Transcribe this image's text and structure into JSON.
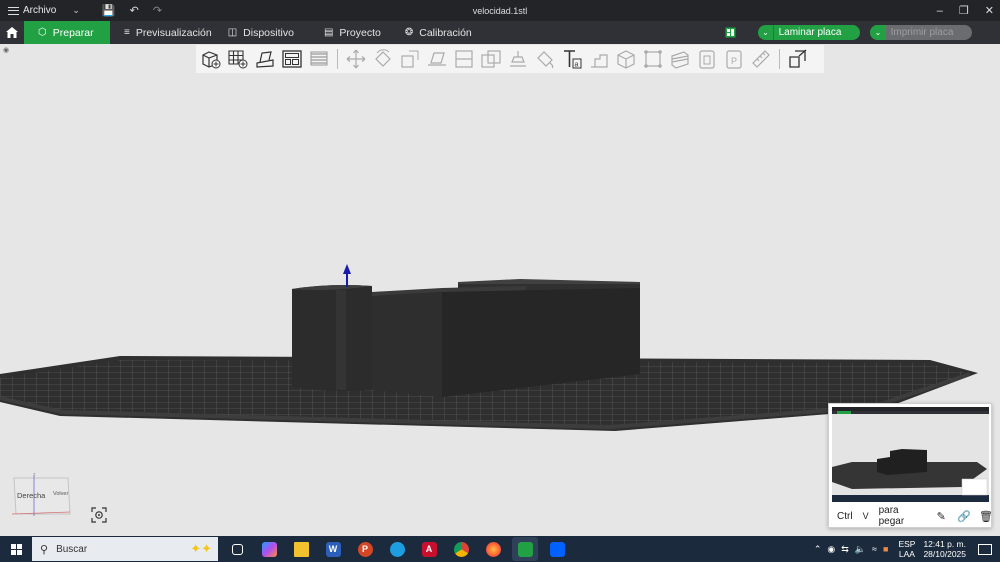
{
  "titlebar": {
    "menu_label": "Archivo",
    "file_title": "velocidad.1stl"
  },
  "tabs": [
    {
      "label": "Preparar",
      "active": true
    },
    {
      "label": "Previsualización"
    },
    {
      "label": "Dispositivo"
    },
    {
      "label": "Proyecto"
    },
    {
      "label": "Calibración"
    }
  ],
  "actions": {
    "slice_label": "Laminar placa",
    "print_label": "Imprimir placa"
  },
  "colors": {
    "accent": "#21a044",
    "titlebar_bg": "#232428",
    "mainbar_bg": "#303136",
    "taskbar_bg": "#1b2a3d",
    "model": "#2b2b2b"
  },
  "tools": [
    "add-object-icon",
    "add-plate-icon",
    "auto-orient-icon",
    "arrange-icon",
    "layers-icon",
    "move-icon",
    "rotate-icon",
    "scale-icon",
    "lay-on-face-icon",
    "cut-icon",
    "boolean-icon",
    "support-paint-icon",
    "seam-paint-icon",
    "text-icon",
    "emboss-icon",
    "mesh-icon",
    "assembly-icon",
    "measure-icon",
    "split-objects-icon",
    "split-parts-icon",
    "variable-layer-icon",
    "ruler-icon",
    "toggle-view-icon"
  ],
  "orientation": {
    "face_label": "Derecha",
    "side_label": "Volver"
  },
  "clipboard": {
    "key1": "Ctrl",
    "key2": "V",
    "paste_label": "para pegar"
  },
  "taskbar": {
    "search_placeholder": "Buscar",
    "lang_line1": "ESP",
    "lang_line2": "LAA",
    "time": "12:41 p. m.",
    "date": "28/10/2025"
  }
}
